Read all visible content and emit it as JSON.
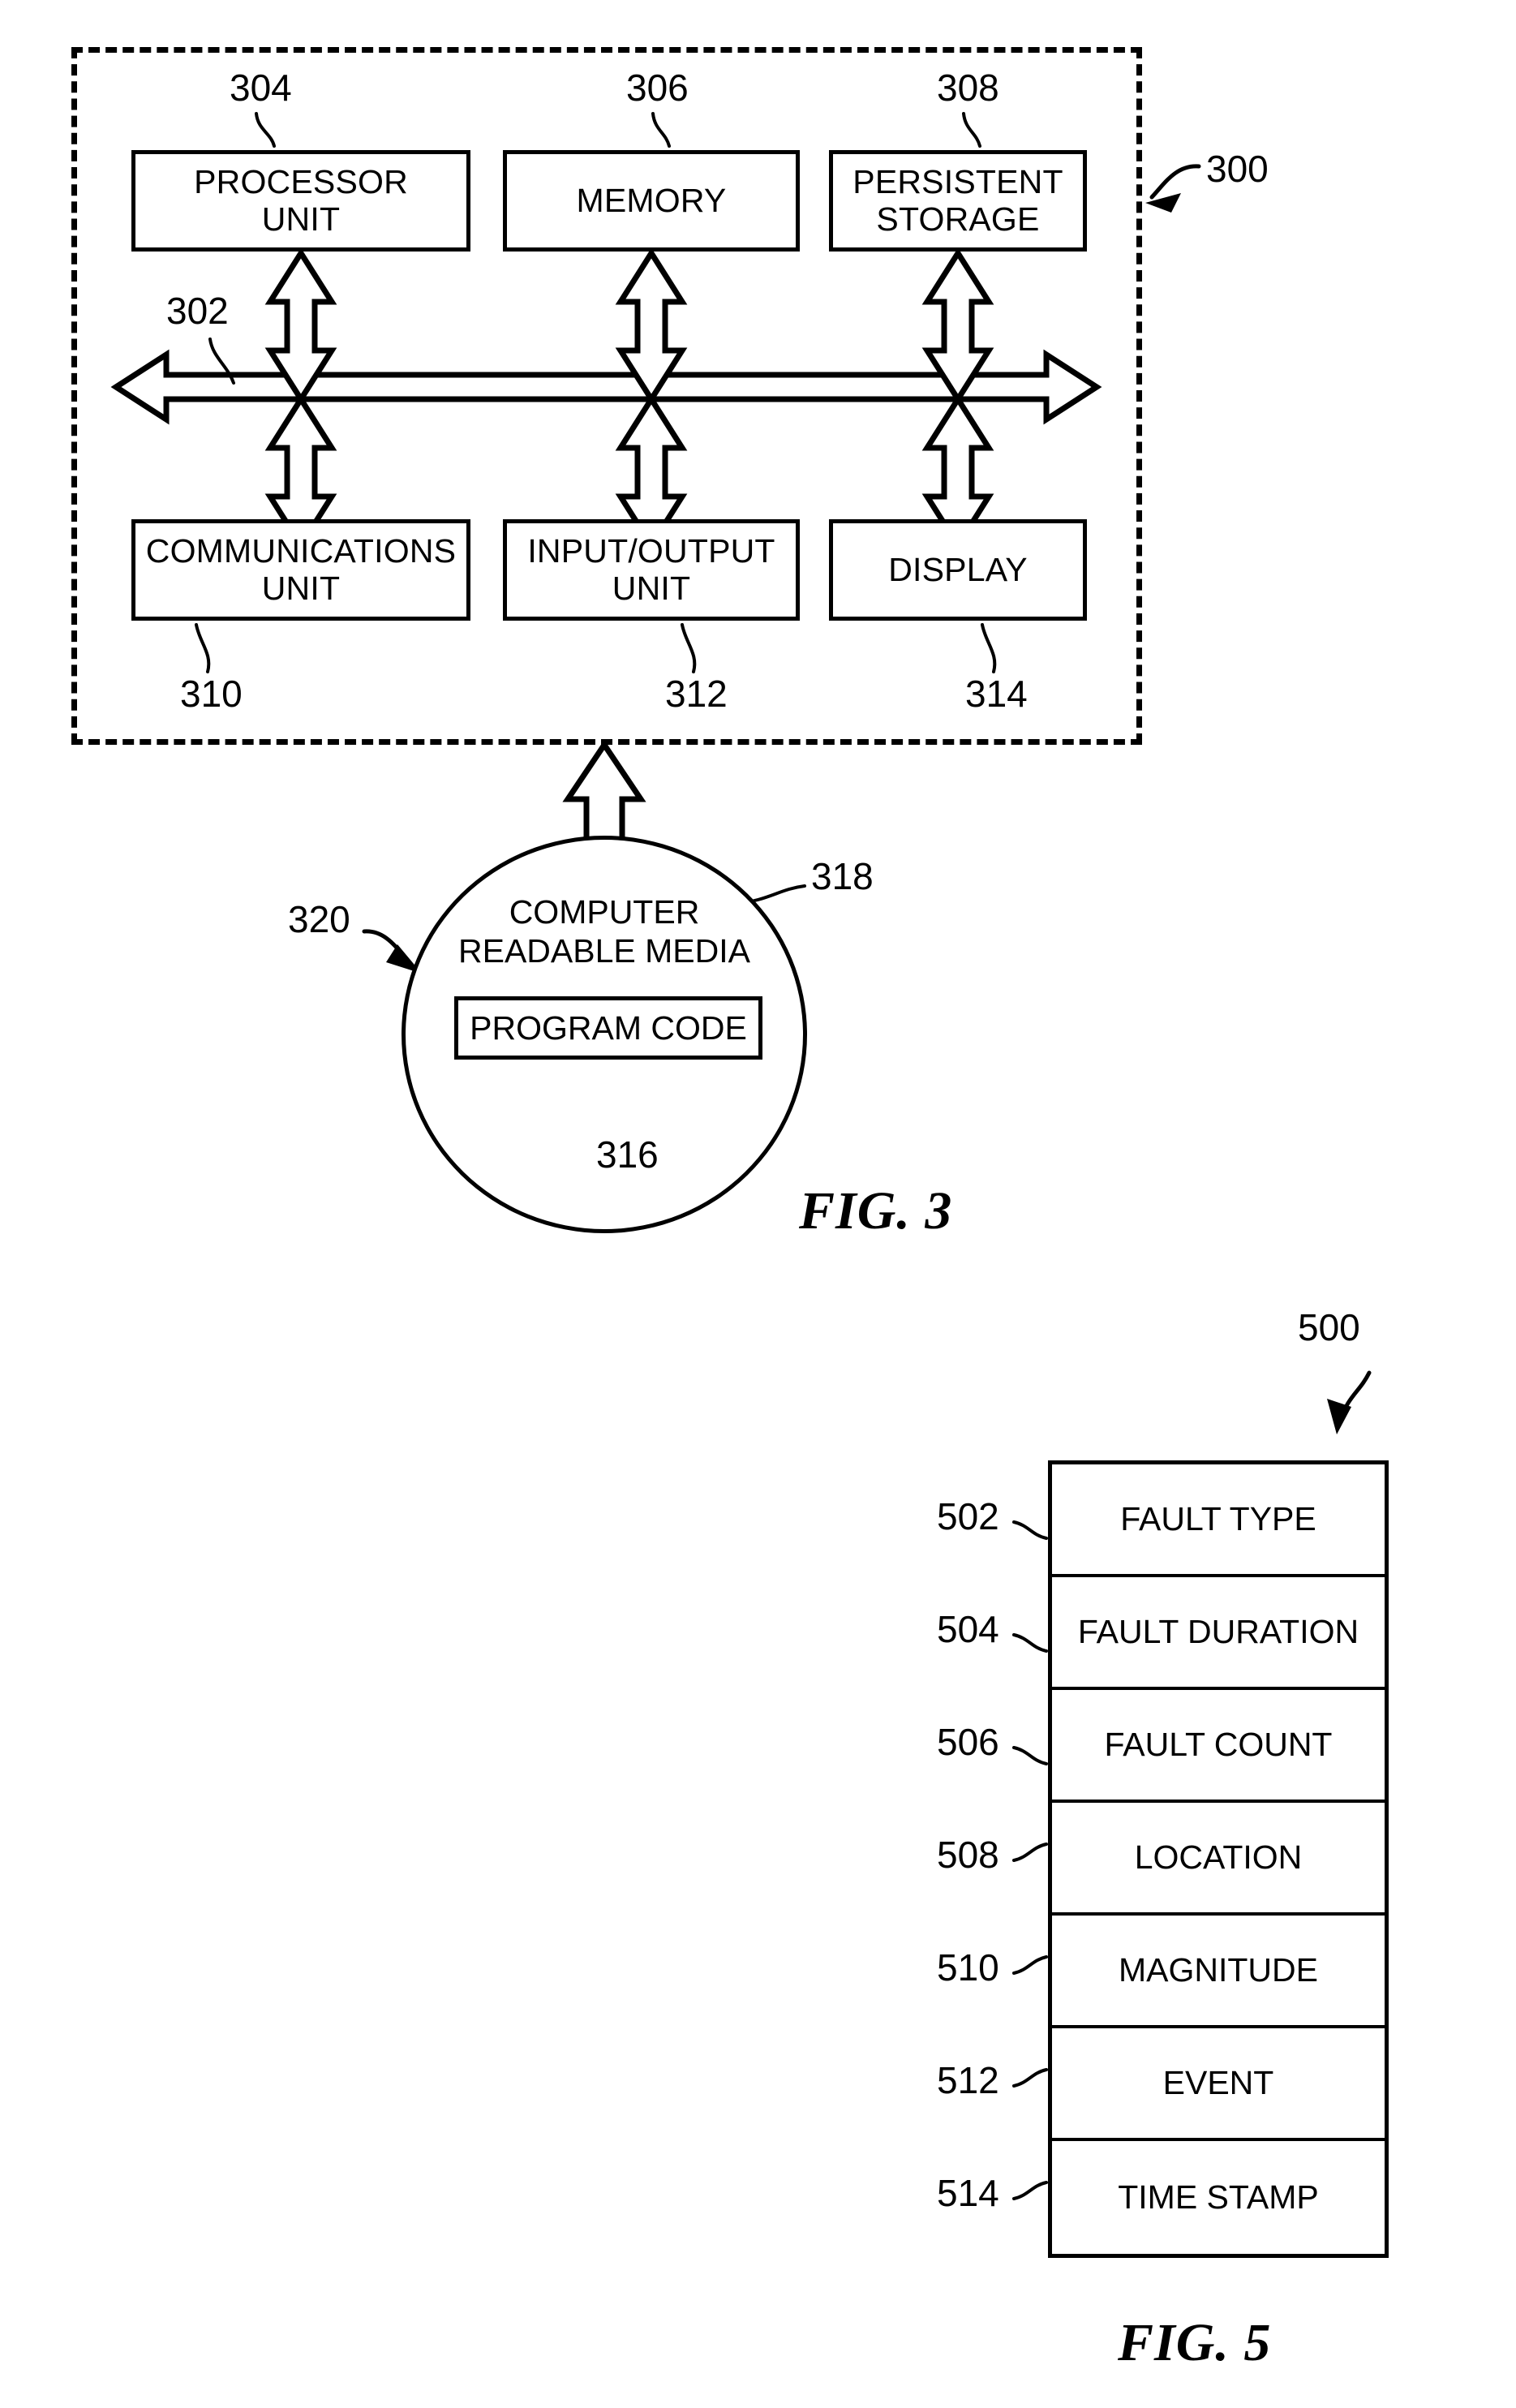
{
  "figure3": {
    "caption": "FIG. 3",
    "system_ref": "300",
    "bus_ref": "302",
    "boxes": [
      {
        "ref": "304",
        "line1": "PROCESSOR",
        "line2": "UNIT"
      },
      {
        "ref": "306",
        "line1": "MEMORY",
        "line2": ""
      },
      {
        "ref": "308",
        "line1": "PERSISTENT",
        "line2": "STORAGE"
      },
      {
        "ref": "310",
        "line1": "COMMUNICATIONS",
        "line2": "UNIT"
      },
      {
        "ref": "312",
        "line1": "INPUT/OUTPUT",
        "line2": "UNIT"
      },
      {
        "ref": "314",
        "line1": "DISPLAY",
        "line2": ""
      }
    ],
    "media": {
      "circle_ref": "320",
      "label_ref": "318",
      "label_line1": "COMPUTER",
      "label_line2": "READABLE MEDIA",
      "code_ref": "316",
      "code_label": "PROGRAM CODE"
    }
  },
  "figure5": {
    "caption": "FIG. 5",
    "table_ref": "500",
    "rows": [
      {
        "ref": "502",
        "label": "FAULT TYPE"
      },
      {
        "ref": "504",
        "label": "FAULT DURATION"
      },
      {
        "ref": "506",
        "label": "FAULT COUNT"
      },
      {
        "ref": "508",
        "label": "LOCATION"
      },
      {
        "ref": "510",
        "label": "MAGNITUDE"
      },
      {
        "ref": "512",
        "label": "EVENT"
      },
      {
        "ref": "514",
        "label": "TIME STAMP"
      }
    ]
  }
}
